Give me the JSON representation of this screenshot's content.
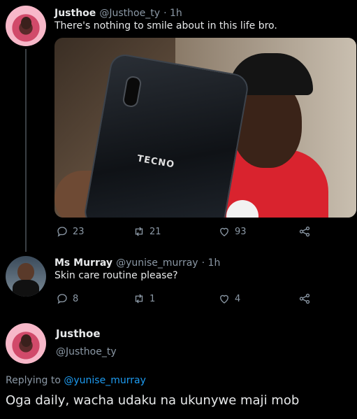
{
  "tweet1": {
    "name": "Justhoe",
    "handle": "@Justhoe_ty",
    "time": "· 1h",
    "text": "There's nothing to smile about in this life bro.",
    "media_brand": "TECNO",
    "replies": "23",
    "retweets": "21",
    "likes": "93"
  },
  "tweet2": {
    "name": "Ms Murray",
    "handle": "@yunise_murray",
    "time": "· 1h",
    "text": "Skin care routine please?",
    "replies": "8",
    "retweets": "1",
    "likes": "4"
  },
  "tweet3": {
    "name": "Justhoe",
    "handle": "@Justhoe_ty",
    "replying_prefix": "Replying to ",
    "replying_handle": "@yunise_murray",
    "text": "Oga daily, wacha udaku na ukunywe maji mob"
  },
  "colors": {
    "background": "#000000",
    "link": "#1d9bf0",
    "muted": "#8b98a5"
  },
  "icons": [
    "reply-icon",
    "retweet-icon",
    "like-icon",
    "share-icon"
  ]
}
